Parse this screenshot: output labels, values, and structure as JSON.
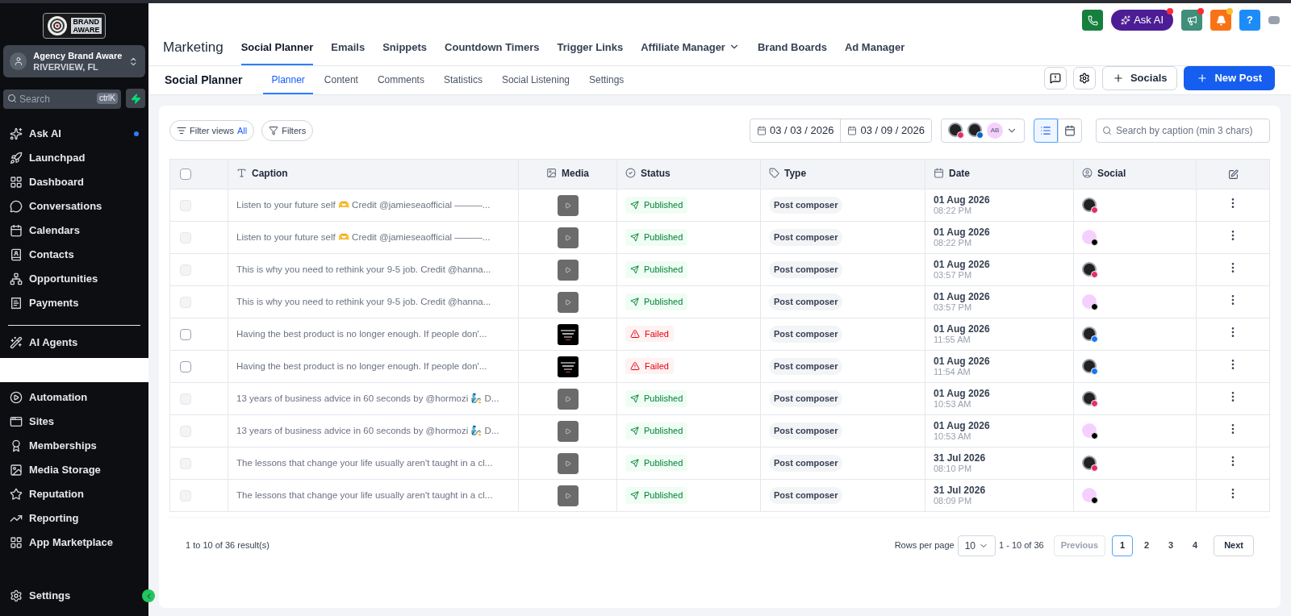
{
  "sidebar": {
    "logo_text": [
      "BRAND",
      "AWARE"
    ],
    "account": {
      "name": "Agency Brand Aware",
      "location": "RIVERVIEW, FL"
    },
    "search": {
      "placeholder": "Search",
      "shortcut": "ctrlK"
    },
    "items": [
      {
        "label": "Ask AI",
        "dot": true
      },
      {
        "label": "Launchpad",
        "dot": false
      },
      {
        "label": "Dashboard",
        "dot": false
      },
      {
        "label": "Conversations",
        "dot": false
      },
      {
        "label": "Calendars",
        "dot": false
      },
      {
        "label": "Contacts",
        "dot": false
      },
      {
        "label": "Opportunities",
        "dot": false
      },
      {
        "label": "Payments",
        "dot": false
      }
    ],
    "agents": {
      "label": "AI Agents"
    },
    "items2": [
      {
        "label": "Automation",
        "dot": false
      },
      {
        "label": "Sites",
        "dot": false
      },
      {
        "label": "Memberships",
        "dot": false
      },
      {
        "label": "Media Storage",
        "dot": false
      },
      {
        "label": "Reputation",
        "dot": false
      },
      {
        "label": "Reporting",
        "dot": false
      },
      {
        "label": "App Marketplace",
        "dot": false
      }
    ],
    "settings": "Settings"
  },
  "topbar": {
    "ask_ai": "Ask AI",
    "help": "?"
  },
  "module": {
    "title": "Marketing",
    "tabs": [
      {
        "label": "Social Planner",
        "selected": true,
        "dropdown": false
      },
      {
        "label": "Emails",
        "selected": false,
        "dropdown": false
      },
      {
        "label": "Snippets",
        "selected": false,
        "dropdown": false
      },
      {
        "label": "Countdown Timers",
        "selected": false,
        "dropdown": false
      },
      {
        "label": "Trigger Links",
        "selected": false,
        "dropdown": false
      },
      {
        "label": "Affiliate Manager",
        "selected": false,
        "dropdown": true
      },
      {
        "label": "Brand Boards",
        "selected": false,
        "dropdown": false
      },
      {
        "label": "Ad Manager",
        "selected": false,
        "dropdown": false
      }
    ]
  },
  "subnav": {
    "title": "Social Planner",
    "tabs": [
      {
        "label": "Planner",
        "selected": true
      },
      {
        "label": "Content",
        "selected": false
      },
      {
        "label": "Comments",
        "selected": false
      },
      {
        "label": "Statistics",
        "selected": false
      },
      {
        "label": "Social Listening",
        "selected": false
      },
      {
        "label": "Settings",
        "selected": false
      }
    ],
    "socials_button": "Socials",
    "new_post_button": "New Post"
  },
  "toolbar": {
    "filter_views": "Filter views",
    "filter_views_value": "All",
    "filters": "Filters",
    "date_from": "03 / 03 / 2026",
    "date_to": "03 / 09 / 2026",
    "account_badge": "AB",
    "search_placeholder": "Search by caption (min 3 chars)",
    "view_buttons": [
      {
        "kind": "list",
        "selected": true
      },
      {
        "kind": "calendar",
        "selected": false
      }
    ]
  },
  "table": {
    "select_all": {
      "checked": false
    },
    "columns": [
      "Caption",
      "Media",
      "Status",
      "Type",
      "Date",
      "Social"
    ],
    "rows": [
      {
        "caption": "Listen to your future self 🫶 Credit @jamieseaofficial ———...",
        "media": {
          "kind": "video"
        },
        "status": {
          "text": "Published",
          "kind": "published"
        },
        "type": "Post composer",
        "date": "01 Aug 2026",
        "time": "08:22 PM",
        "social": {
          "kind": "instagram"
        },
        "disabled": true
      },
      {
        "caption": "Listen to your future self 🫶 Credit @jamieseaofficial ———...",
        "media": {
          "kind": "video"
        },
        "status": {
          "text": "Published",
          "kind": "published"
        },
        "type": "Post composer",
        "date": "01 Aug 2026",
        "time": "08:22 PM",
        "social": {
          "kind": "tiktok"
        },
        "disabled": true
      },
      {
        "caption": "This is why you need to rethink your 9-5 job. Credit @hanna...",
        "media": {
          "kind": "video"
        },
        "status": {
          "text": "Published",
          "kind": "published"
        },
        "type": "Post composer",
        "date": "01 Aug 2026",
        "time": "03:57 PM",
        "social": {
          "kind": "instagram"
        },
        "disabled": true
      },
      {
        "caption": "This is why you need to rethink your 9-5 job. Credit @hanna...",
        "media": {
          "kind": "video"
        },
        "status": {
          "text": "Published",
          "kind": "published"
        },
        "type": "Post composer",
        "date": "01 Aug 2026",
        "time": "03:57 PM",
        "social": {
          "kind": "tiktok"
        },
        "disabled": true
      },
      {
        "caption": "Having the best product is no longer enough. If people don'...",
        "status": {
          "text": "Failed",
          "kind": "failed"
        },
        "type": "Post composer",
        "date": "01 Aug 2026",
        "time": "11:55 AM",
        "social": {
          "kind": "facebook"
        },
        "disabled": false
      },
      {
        "caption": "Having the best product is no longer enough. If people don'...",
        "status": {
          "text": "Failed",
          "kind": "failed"
        },
        "type": "Post composer",
        "date": "01 Aug 2026",
        "time": "11:54 AM",
        "social": {
          "kind": "facebook"
        },
        "disabled": false
      },
      {
        "caption": "13 years of business advice in 60 seconds by @hormozi 🧞 D...",
        "media": {
          "kind": "video"
        },
        "status": {
          "text": "Published",
          "kind": "published"
        },
        "type": "Post composer",
        "date": "01 Aug 2026",
        "time": "10:53 AM",
        "social": {
          "kind": "instagram"
        },
        "disabled": true
      },
      {
        "caption": "13 years of business advice in 60 seconds by @hormozi 🧞 D...",
        "media": {
          "kind": "video"
        },
        "status": {
          "text": "Published",
          "kind": "published"
        },
        "type": "Post composer",
        "date": "01 Aug 2026",
        "time": "10:53 AM",
        "social": {
          "kind": "tiktok"
        },
        "disabled": true
      },
      {
        "caption": "The lessons that change your life usually aren't taught in a cl...",
        "media": {
          "kind": "video"
        },
        "status": {
          "text": "Published",
          "kind": "published"
        },
        "type": "Post composer",
        "date": "31 Jul 2026",
        "time": "08:10 PM",
        "social": {
          "kind": "instagram"
        },
        "disabled": true
      },
      {
        "caption": "The lessons that change your life usually aren't taught in a cl...",
        "media": {
          "kind": "video"
        },
        "status": {
          "text": "Published",
          "kind": "published"
        },
        "type": "Post composer",
        "date": "31 Jul 2026",
        "time": "08:09 PM",
        "social": {
          "kind": "tiktok"
        },
        "disabled": true
      }
    ]
  },
  "footer": {
    "summary": "1 to 10 of 36 result(s)",
    "rows_per_page_label": "Rows per page",
    "rows_per_page": "10",
    "range": "1 - 10 of 36",
    "previous": "Previous",
    "pages": [
      {
        "label": "1",
        "selected": true
      },
      {
        "label": "2",
        "selected": false
      },
      {
        "label": "3",
        "selected": false
      },
      {
        "label": "4",
        "selected": false
      }
    ],
    "next": "Next"
  }
}
